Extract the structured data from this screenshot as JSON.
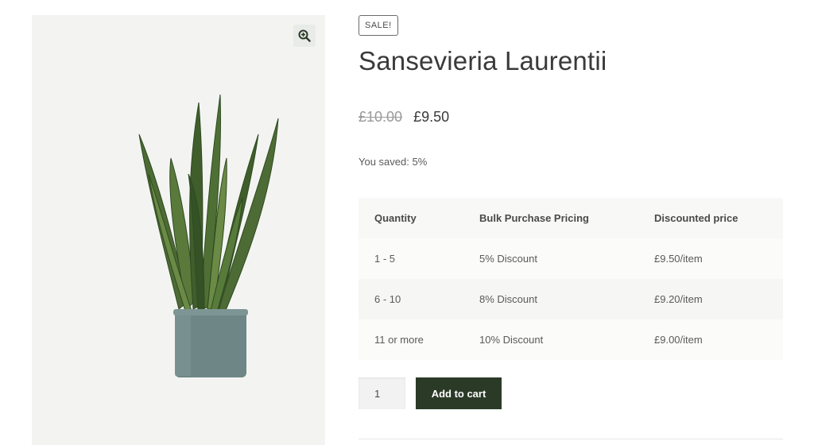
{
  "product": {
    "badge": "SALE!",
    "title": "Sansevieria Laurentii",
    "old_price": "£10.00",
    "new_price": "£9.50",
    "saved_text": "You saved: 5%"
  },
  "pricing_table": {
    "headers": [
      "Quantity",
      "Bulk Purchase Pricing",
      "Discounted price"
    ],
    "rows": [
      [
        "1 - 5",
        "5% Discount",
        "£9.50/item"
      ],
      [
        "6 - 10",
        "8% Discount",
        "£9.20/item"
      ],
      [
        "11 or more",
        "10% Discount",
        "£9.00/item"
      ]
    ]
  },
  "cart": {
    "quantity_value": "1",
    "add_label": "Add to cart"
  },
  "icons": {
    "zoom": "zoom-in-icon"
  },
  "colors": {
    "button_bg": "#2a3a27",
    "gallery_bg": "#f3f4f2"
  }
}
